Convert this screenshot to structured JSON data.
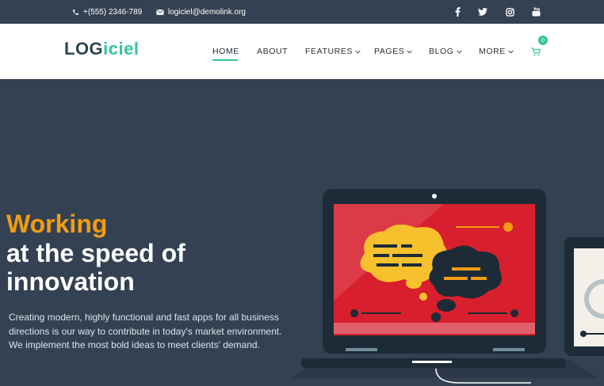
{
  "topbar": {
    "phone": "+(555) 2346-789",
    "email": "logiciel@demolink.org",
    "social": [
      "facebook-icon",
      "twitter-icon",
      "instagram-icon",
      "youtube-icon"
    ]
  },
  "logo": {
    "part1": "LOG",
    "part2": "iciel"
  },
  "nav": {
    "items": [
      {
        "label": "HOME",
        "active": true,
        "dropdown": false
      },
      {
        "label": "ABOUT",
        "active": false,
        "dropdown": false
      },
      {
        "label": "FEATURES",
        "active": false,
        "dropdown": true
      },
      {
        "label": "PAGES",
        "active": false,
        "dropdown": true
      },
      {
        "label": "BLOG",
        "active": false,
        "dropdown": true
      },
      {
        "label": "MORE",
        "active": false,
        "dropdown": true
      }
    ],
    "cart_count": "0"
  },
  "hero": {
    "title_accent": "Working",
    "title_line2": "at the speed of",
    "title_line3": "innovation",
    "description": "Creating modern, highly functional and fast apps for all business directions is our way to contribute in today's market environment. We implement the most bold ideas to meet clients' demand."
  },
  "colors": {
    "bg": "#344152",
    "accent_green": "#35c4a0",
    "accent_orange": "#f39c12",
    "screen_red": "#d71f2d"
  }
}
